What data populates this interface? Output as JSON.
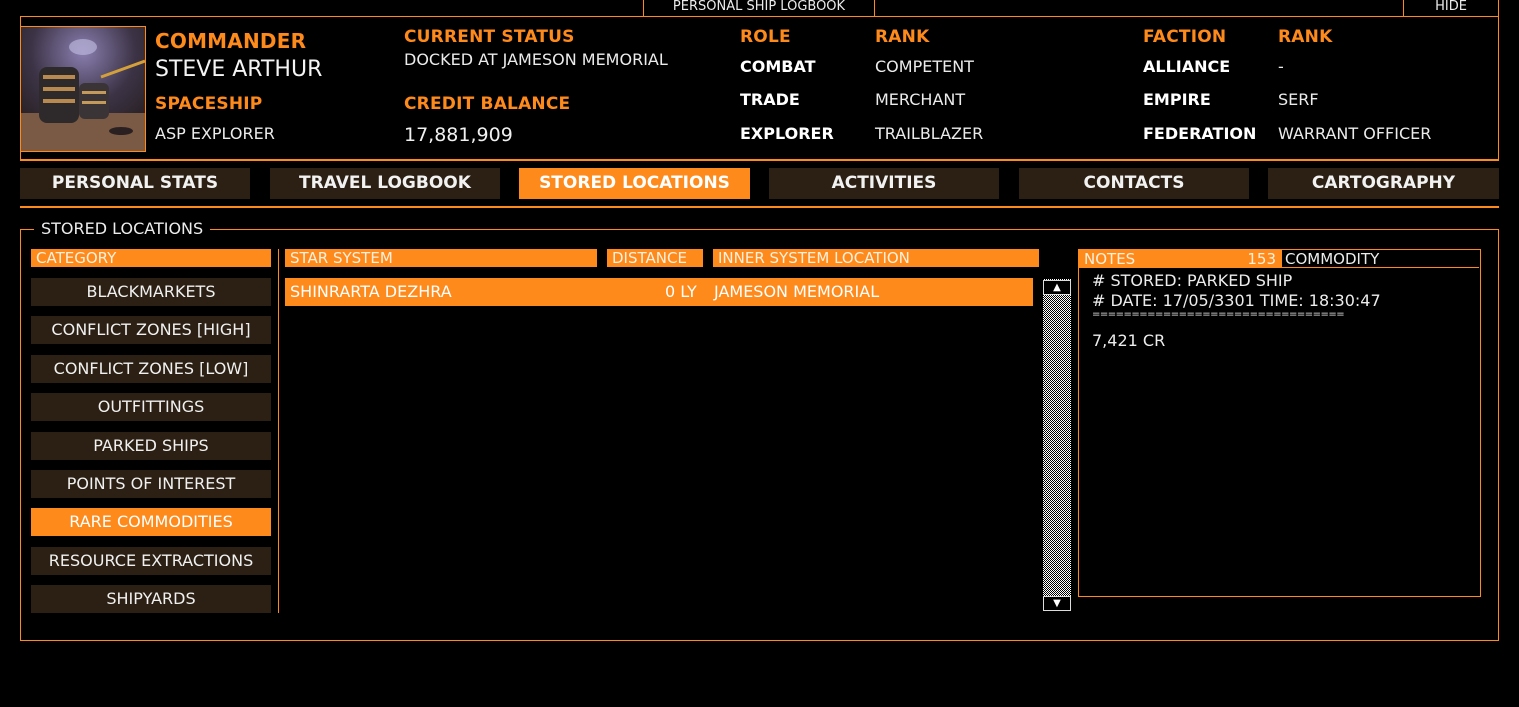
{
  "window": {
    "title": "PERSONAL SHIP LOGBOOK",
    "hide_label": "HIDE"
  },
  "commander": {
    "label": "COMMANDER",
    "name": "STEVE ARTHUR",
    "spaceship_label": "SPACESHIP",
    "spaceship": "ASP EXPLORER"
  },
  "status": {
    "label": "CURRENT STATUS",
    "value": "DOCKED AT JAMESON MEMORIAL",
    "credit_label": "CREDIT BALANCE",
    "credit_value": "17,881,909"
  },
  "roles": {
    "role_label": "ROLE",
    "rank_label": "RANK",
    "rows": [
      {
        "role": "COMBAT",
        "rank": "COMPETENT"
      },
      {
        "role": "TRADE",
        "rank": "MERCHANT"
      },
      {
        "role": "EXPLORER",
        "rank": "TRAILBLAZER"
      }
    ]
  },
  "factions": {
    "faction_label": "FACTION",
    "rank_label": "RANK",
    "rows": [
      {
        "faction": "ALLIANCE",
        "rank": "-"
      },
      {
        "faction": "EMPIRE",
        "rank": "SERF"
      },
      {
        "faction": "FEDERATION",
        "rank": "WARRANT OFFICER"
      }
    ]
  },
  "tabs": [
    {
      "label": "PERSONAL STATS"
    },
    {
      "label": "TRAVEL LOGBOOK"
    },
    {
      "label": "STORED LOCATIONS",
      "active": true
    },
    {
      "label": "ACTIVITIES"
    },
    {
      "label": "CONTACTS"
    },
    {
      "label": "CARTOGRAPHY"
    }
  ],
  "panel": {
    "title": "STORED LOCATIONS",
    "category_header": "CATEGORY",
    "categories": [
      "BLACKMARKETS",
      "CONFLICT ZONES [HIGH]",
      "CONFLICT ZONES [LOW]",
      "OUTFITTINGS",
      "PARKED SHIPS",
      "POINTS OF INTEREST",
      "RARE COMMODITIES",
      "RESOURCE EXTRACTIONS",
      "SHIPYARDS"
    ],
    "active_category": "RARE COMMODITIES",
    "columns": {
      "star_system": "STAR SYSTEM",
      "distance": "DISTANCE",
      "inner_location": "INNER SYSTEM LOCATION"
    },
    "rows": [
      {
        "star_system": "SHINRARTA DEZHRA",
        "distance": "0 LY",
        "inner_location": "JAMESON MEMORIAL"
      }
    ]
  },
  "notes": {
    "header": "NOTES",
    "count": "153",
    "commodity_header": "COMMODITY",
    "lines": [
      "# STORED: PARKED SHIP",
      "# DATE: 17/05/3301 TIME: 18:30:47",
      "================================",
      "7,421 CR"
    ]
  },
  "colors": {
    "accent": "#ff8a1c",
    "tab_bg": "#2b2013",
    "background": "#000000"
  },
  "icons": {
    "scroll_up": "triangle-up-icon",
    "scroll_down": "triangle-down-icon"
  }
}
